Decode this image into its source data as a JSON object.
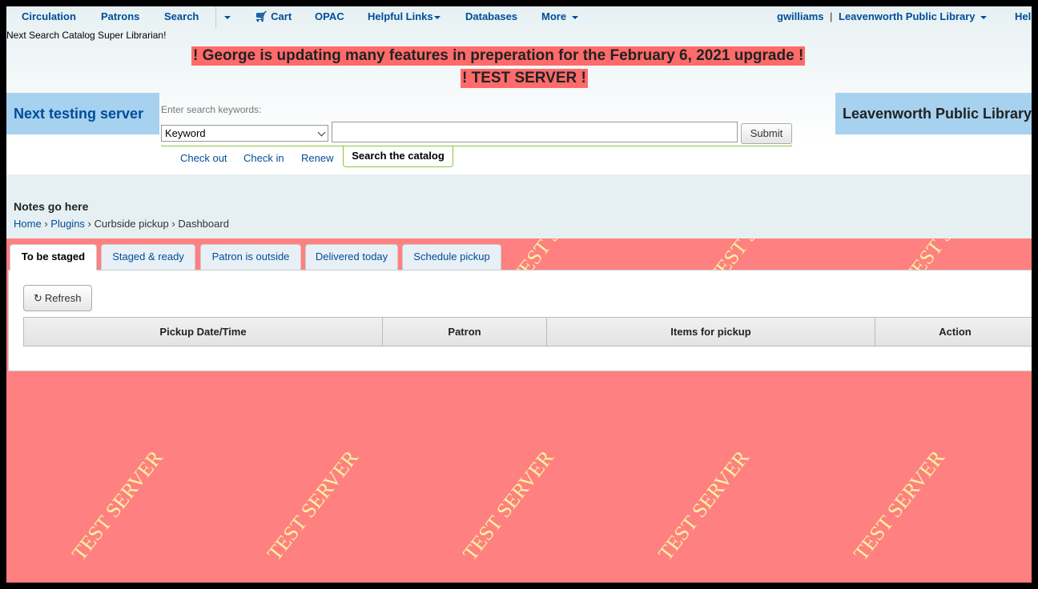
{
  "nav": {
    "circulation": "Circulation",
    "patrons": "Patrons",
    "search": "Search",
    "cart": "Cart",
    "opac": "OPAC",
    "helpful_links": "Helpful Links",
    "databases": "Databases",
    "more": "More",
    "user": "gwilliams",
    "separator": "|",
    "library": "Leavenworth Public Library",
    "help": "Help"
  },
  "subtitle": "Next Search Catalog Super Librarian!",
  "banners": {
    "update_notice": "! George is updating many features in preperation for the February 6, 2021 upgrade !",
    "test_server": "! TEST SERVER !"
  },
  "server_boxes": {
    "left": "Next testing server",
    "right": "Leavenworth Public Library"
  },
  "search": {
    "label": "Enter search keywords:",
    "select_value": "Keyword",
    "input_value": "",
    "submit": "Submit",
    "tabs": [
      "Check out",
      "Check in",
      "Renew"
    ],
    "active_tab": "Search the catalog"
  },
  "notes": "Notes go here",
  "breadcrumb": {
    "home": "Home",
    "plugins": "Plugins",
    "curbside": "Curbside pickup",
    "current": "Dashboard",
    "sep": "›"
  },
  "tabs": [
    {
      "label": "To be staged",
      "active": true
    },
    {
      "label": "Staged & ready",
      "active": false
    },
    {
      "label": "Patron is outside",
      "active": false
    },
    {
      "label": "Delivered today",
      "active": false
    },
    {
      "label": "Schedule pickup",
      "active": false
    }
  ],
  "panel": {
    "refresh_label": "Refresh",
    "columns": [
      "Pickup Date/Time",
      "Patron",
      "Items for pickup",
      "Action"
    ]
  },
  "watermark_text": "TEST SERVER",
  "colors": {
    "background": "#ff8080",
    "banner": "#ff6b6b",
    "link": "#004d99",
    "server_box": "#a6d1ef",
    "watermark": "#f8f3a0",
    "search_accent": "#8fc43f"
  }
}
